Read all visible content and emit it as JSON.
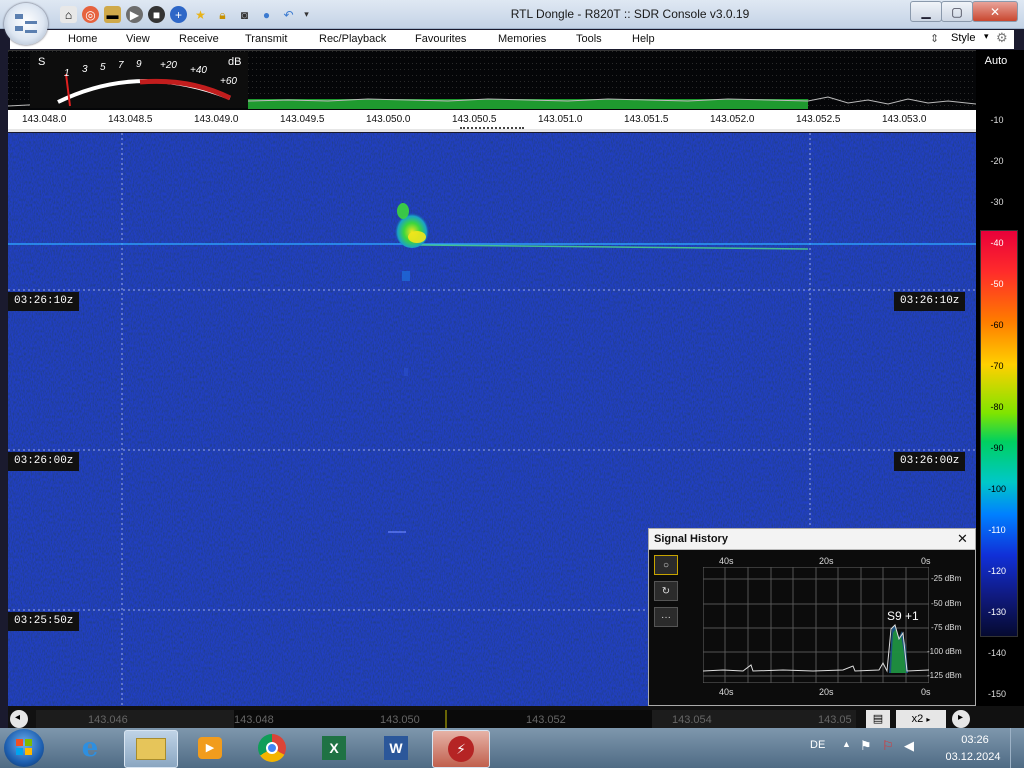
{
  "window": {
    "title": "RTL Dongle - R820T :: SDR Console v3.0.19",
    "minimize_icon": "minimize-icon",
    "maximize_icon": "maximize-icon",
    "close_icon": "close-icon"
  },
  "quick_access": [
    {
      "name": "home-icon"
    },
    {
      "name": "lifebuoy-icon"
    },
    {
      "name": "folder-icon"
    },
    {
      "name": "play-icon"
    },
    {
      "name": "stop-icon"
    },
    {
      "name": "add-icon"
    },
    {
      "name": "star-icon"
    },
    {
      "name": "lock-icon"
    },
    {
      "name": "camera-icon"
    },
    {
      "name": "water-drop-icon"
    },
    {
      "name": "undo-icon"
    },
    {
      "name": "dropdown-icon"
    }
  ],
  "menu": {
    "items": [
      "Home",
      "View",
      "Receive",
      "Transmit",
      "Rec/Playback",
      "Favourites",
      "Memories",
      "Tools",
      "Help"
    ],
    "style_label": "Style"
  },
  "smeter": {
    "s_label": "S",
    "db_label": "dB",
    "scale": [
      "1",
      "3",
      "5",
      "7",
      "9",
      "+20",
      "+40",
      "+60"
    ]
  },
  "frequency_axis": [
    "143.048.0",
    "143.048.5",
    "143.049.0",
    "143.049.5",
    "143.050.0",
    "143.050.5",
    "143.051.0",
    "143.051.5",
    "143.052.0",
    "143.052.5",
    "143.053.0"
  ],
  "waterfall": {
    "time_labels": [
      "03:26:10z",
      "03:26:00z",
      "03:25:50z"
    ]
  },
  "level_scale": {
    "auto_label": "Auto",
    "labels": [
      "-10",
      "-20",
      "-30",
      "-40",
      "-50",
      "-60",
      "-70",
      "-80",
      "-90",
      "-100",
      "-110",
      "-120",
      "-130",
      "-140",
      "-150"
    ]
  },
  "signal_history": {
    "title": "Signal History",
    "top_time_labels": [
      "40s",
      "20s",
      "0s"
    ],
    "bottom_time_labels": [
      "40s",
      "20s",
      "0s"
    ],
    "dbm_labels": [
      "-25 dBm",
      "-50 dBm",
      "-75 dBm",
      "-100 dBm",
      "-125 dBm"
    ],
    "peak_label": "S9 +1",
    "buttons": [
      "record-icon",
      "reset-icon",
      "more-icon"
    ]
  },
  "scroll_ruler": {
    "ticks": [
      "143.046",
      "143.048",
      "143.050",
      "143.052",
      "143.054",
      "143.05"
    ],
    "zoom": "x2"
  },
  "taskbar": {
    "language": "DE",
    "time": "03:26",
    "date": "03.12.2024",
    "apps": [
      "internet-explorer-icon",
      "file-explorer-icon",
      "media-player-icon",
      "chrome-icon",
      "excel-icon",
      "word-icon",
      "sdr-console-icon"
    ]
  },
  "colors": {
    "waterfall_bg": "#0b1a8a",
    "signal_peak": "#e9ef1a",
    "spectrum_green": "#1f9a2f"
  }
}
